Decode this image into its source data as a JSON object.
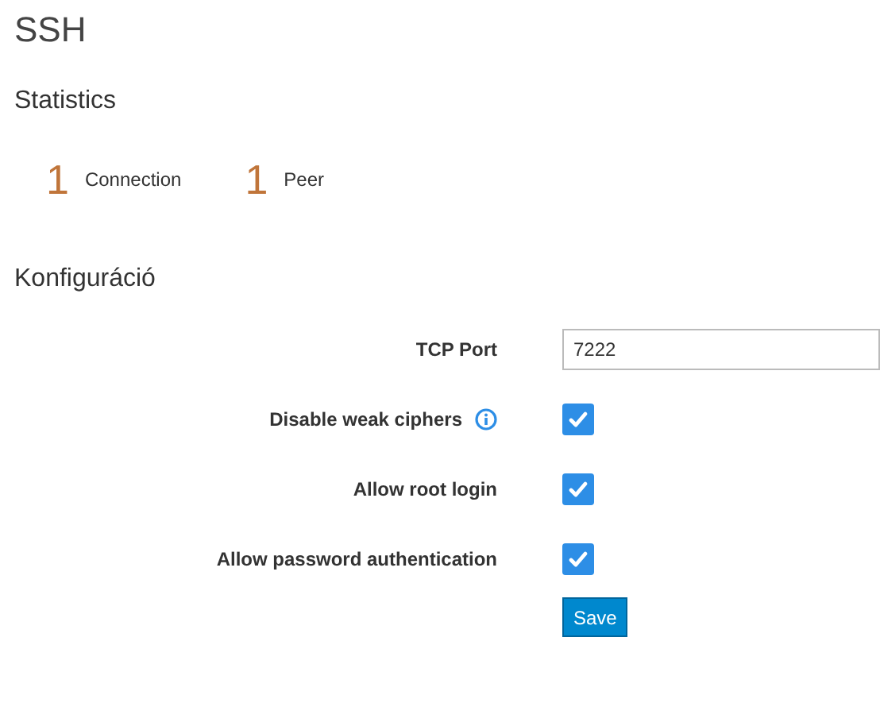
{
  "title": "SSH",
  "statistics": {
    "heading": "Statistics",
    "items": [
      {
        "value": "1",
        "label": "Connection"
      },
      {
        "value": "1",
        "label": "Peer"
      }
    ]
  },
  "configuration": {
    "heading": "Konfiguráció",
    "fields": [
      {
        "kind": "text",
        "label": "TCP Port",
        "value": "7222"
      },
      {
        "kind": "checkbox",
        "label": "Disable weak ciphers",
        "checked": true,
        "info": true
      },
      {
        "kind": "checkbox",
        "label": "Allow root login",
        "checked": true
      },
      {
        "kind": "checkbox",
        "label": "Allow password authentication",
        "checked": true
      }
    ],
    "save_button": "Save"
  }
}
